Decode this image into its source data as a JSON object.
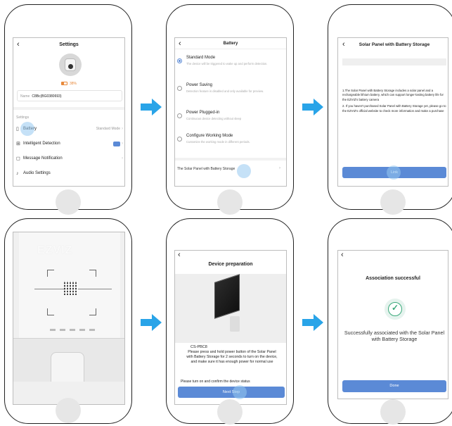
{
  "colors": {
    "accent": "#5b8ad6",
    "arrow": "#29a4e8",
    "success": "#3aa97a",
    "battery": "#e8893b"
  },
  "screen1": {
    "back_icon": "chevron-left-icon",
    "title": "Settings",
    "battery_level": "38%",
    "name_label": "Name",
    "name_value": "C8Bc(BG0380693)",
    "section_label": "Settings",
    "rows": [
      {
        "icon": "battery-icon",
        "label": "Battery",
        "value": "Standard Mode"
      },
      {
        "icon": "grid-icon",
        "label": "Intelligent Detection",
        "value": ""
      },
      {
        "icon": "bell-icon",
        "label": "Message Notification",
        "value": ""
      },
      {
        "icon": "audio-icon",
        "label": "Audio Settings",
        "value": ""
      }
    ]
  },
  "screen2": {
    "title": "Battery",
    "options": [
      {
        "title": "Standard Mode",
        "desc": "The device will be triggered to wake up and perform detection.",
        "selected": true
      },
      {
        "title": "Power Saving",
        "desc": "Detection feature is disabled and only available for preview.",
        "selected": false
      },
      {
        "title": "Power Plugged-in",
        "desc": "Continuous device detecting without sleep",
        "selected": false
      },
      {
        "title": "Configure Working Mode",
        "desc": "Customize the working mode in different periods.",
        "selected": false
      }
    ],
    "link_text": "The Solar Panel with Battery Storage"
  },
  "screen3": {
    "title": "Solar Panel with Battery Storage",
    "para1": "1.The Solar Panel with Battery Storage includes a solar panel and a rechargeable lithium battery, which can support longer-lasting battery life for the EZVIZ's battery camera",
    "para2": "2. If you haven't purchased Solar Panel with Battery Storage yet, please go to the EZVIZ's official website to check more information and make a purchase",
    "button": "Link"
  },
  "screen4": {
    "logo_text": "EZVIZ"
  },
  "screen5": {
    "title": "Device preparation",
    "model": "CS-PBC8",
    "instruction": "Please press and hold power button of the Solar Panel with Battery Storage for 2 seconds to turn on the device, and make sure it has enough power for normal use",
    "confirm": "Please turn on and confirm the device status",
    "button": "Next Step"
  },
  "screen6": {
    "title": "Association successful",
    "message": "Successfully associated with the Solar Panel with Battery Storage",
    "button": "Done"
  }
}
